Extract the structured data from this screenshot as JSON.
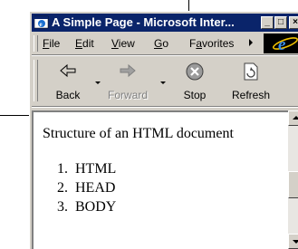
{
  "window": {
    "title": "A Simple Page - Microsoft Inter...",
    "controls": {
      "minimize": "_",
      "maximize": "□",
      "close": "×"
    }
  },
  "menu": {
    "items": [
      {
        "label": "File",
        "accel": "F",
        "rest": "ile"
      },
      {
        "label": "Edit",
        "accel": "E",
        "rest": "dit"
      },
      {
        "label": "View",
        "accel": "V",
        "rest": "iew"
      },
      {
        "label": "Go",
        "accel": "G",
        "rest": "o"
      },
      {
        "label": "Favorites",
        "accel": "a",
        "pre": "F",
        "rest": "vorites"
      }
    ]
  },
  "toolbar": {
    "back": "Back",
    "forward": "Forward",
    "stop": "Stop",
    "refresh": "Refresh"
  },
  "page": {
    "heading": "Structure of an HTML document",
    "list": [
      {
        "num": "1.",
        "text": "HTML"
      },
      {
        "num": "2.",
        "text": "HEAD"
      },
      {
        "num": "3.",
        "text": "BODY"
      }
    ]
  },
  "icons": {
    "app": "ie-window-icon",
    "brand": "ie-logo-icon",
    "back": "back-arrow-icon",
    "forward": "forward-arrow-icon",
    "stop": "stop-icon",
    "refresh": "refresh-icon"
  },
  "colors": {
    "titlebar": "#0a246a",
    "chrome": "#d4d0c8",
    "content_bg": "#ffffff"
  }
}
